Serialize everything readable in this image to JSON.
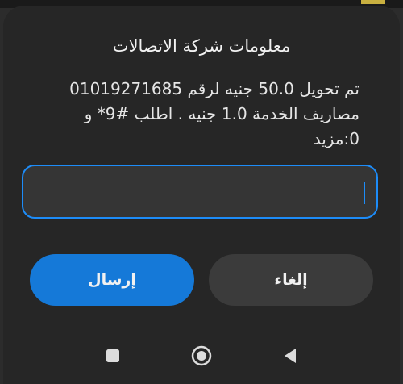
{
  "dialog": {
    "title": "معلومات شركة الاتصالات",
    "message_lines": [
      "تم تحويل 50.0 جنيه لرقم 01019271685",
      "مصاريف الخدمة 1.0 جنيه . اطلب #9* و",
      "0:مزيد"
    ],
    "input": {
      "value": "",
      "placeholder": ""
    },
    "send_label": "إرسال",
    "cancel_label": "إلغاء"
  },
  "navbar": {
    "icons": [
      "recents-icon",
      "home-icon",
      "back-icon"
    ]
  },
  "colors": {
    "dialog_bg": "#262626",
    "accent": "#1579d8",
    "input_border": "#1d8cf8",
    "cancel_bg": "#3b3b3b",
    "text": "#f1f1f1"
  }
}
